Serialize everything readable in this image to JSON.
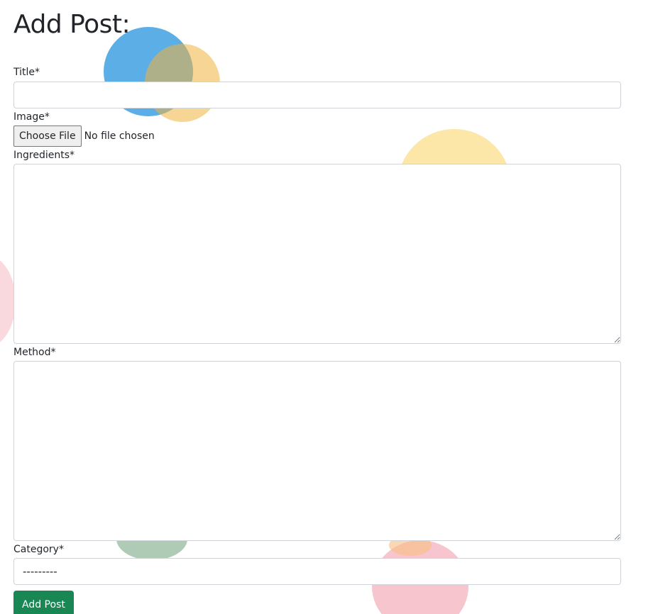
{
  "page": {
    "title": "Add Post:"
  },
  "form": {
    "title_label": "Title*",
    "title_value": "",
    "image_label": "Image*",
    "image_button_label": "Choose File",
    "image_status": "No file chosen",
    "ingredients_label": "Ingredients*",
    "ingredients_value": "",
    "method_label": "Method*",
    "method_value": "",
    "category_label": "Category*",
    "category_selected": "---------",
    "submit_label": "Add Post"
  },
  "colors": {
    "submit_button": "#198754",
    "input_border": "#ced4da",
    "text": "#212529"
  }
}
